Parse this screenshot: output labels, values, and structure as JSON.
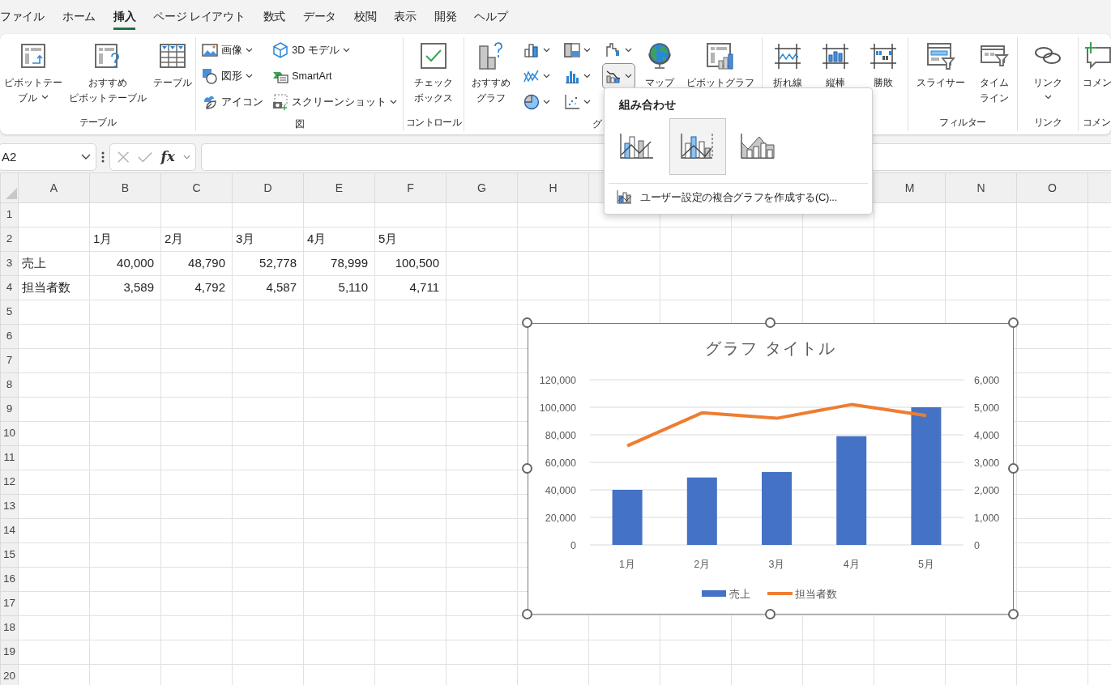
{
  "menu_tabs": [
    {
      "label": "ファイル",
      "selected": false
    },
    {
      "label": "ホーム",
      "selected": false
    },
    {
      "label": "挿入",
      "selected": true
    },
    {
      "label": "ページ レイアウト",
      "selected": false
    },
    {
      "label": "数式",
      "selected": false
    },
    {
      "label": "データ",
      "selected": false
    },
    {
      "label": "校閲",
      "selected": false
    },
    {
      "label": "表示",
      "selected": false
    },
    {
      "label": "開発",
      "selected": false
    },
    {
      "label": "ヘルプ",
      "selected": false
    }
  ],
  "ribbon": {
    "groups": [
      {
        "label": "テーブル",
        "items": [
          {
            "kind": "large",
            "lines": [
              "ピボットテー",
              "ブル"
            ],
            "dropdown": true
          },
          {
            "kind": "large",
            "lines": [
              "おすすめ",
              "ピボットテーブル"
            ],
            "dropdown": false
          },
          {
            "kind": "large",
            "lines": [
              "テーブル"
            ],
            "dropdown": false
          }
        ]
      },
      {
        "label": "図",
        "items": [
          {
            "kind": "small",
            "label": "画像",
            "dropdown": true
          },
          {
            "kind": "small",
            "label": "図形",
            "dropdown": true
          },
          {
            "kind": "small",
            "label": "アイコン",
            "dropdown": false
          },
          {
            "kind": "small",
            "label": "3D モデル",
            "dropdown": true
          },
          {
            "kind": "small",
            "label": "SmartArt",
            "dropdown": false
          },
          {
            "kind": "small",
            "label": "スクリーンショット",
            "dropdown": true
          }
        ]
      },
      {
        "label": "コントロール",
        "items": [
          {
            "kind": "large",
            "lines": [
              "チェック",
              "ボックス"
            ],
            "dropdown": false
          }
        ]
      },
      {
        "label": "グ",
        "items": [
          {
            "kind": "large",
            "lines": [
              "おすすめ",
              "グラフ"
            ],
            "dropdown": false
          },
          {
            "kind": "icon",
            "dropdown": true,
            "pressed": false
          },
          {
            "kind": "icon",
            "dropdown": true,
            "pressed": false
          },
          {
            "kind": "icon",
            "dropdown": true,
            "pressed": false
          },
          {
            "kind": "icon",
            "dropdown": true,
            "pressed": false
          },
          {
            "kind": "icon",
            "dropdown": true,
            "pressed": false
          },
          {
            "kind": "icon",
            "dropdown": true,
            "pressed": false
          },
          {
            "kind": "icon",
            "dropdown": true,
            "pressed": false
          },
          {
            "kind": "icon",
            "dropdown": true,
            "pressed": true
          },
          {
            "kind": "large",
            "lines": [
              "マップ"
            ],
            "dropdown": false
          },
          {
            "kind": "large",
            "lines": [
              "ピボットグラフ"
            ],
            "dropdown": false
          }
        ]
      },
      {
        "items": [
          {
            "kind": "large",
            "lines": [
              "折れ線"
            ],
            "dropdown": false
          },
          {
            "kind": "large",
            "lines": [
              "縦棒"
            ],
            "dropdown": false
          },
          {
            "kind": "large",
            "lines": [
              "勝敗"
            ],
            "dropdown": false
          }
        ]
      },
      {
        "label": "フィルター",
        "items": [
          {
            "kind": "large",
            "lines": [
              "スライサー"
            ],
            "dropdown": false
          },
          {
            "kind": "large",
            "lines": [
              "タイム",
              "ライン"
            ],
            "dropdown": false
          }
        ]
      },
      {
        "label": "リンク",
        "items": [
          {
            "kind": "large",
            "lines": [
              "リンク"
            ],
            "dropdown": true
          }
        ]
      },
      {
        "label": "コメン",
        "items": [
          {
            "kind": "large",
            "lines": [
              "コメン"
            ],
            "dropdown": false
          }
        ]
      }
    ]
  },
  "combo_menu": {
    "title": "組み合わせ",
    "options": [
      {
        "selected": false
      },
      {
        "selected": true
      },
      {
        "selected": false
      }
    ],
    "items": [
      {
        "label": "ユーザー設定の複合グラフを作成する(C)..."
      }
    ]
  },
  "formula_bar": {
    "name_box": "A2",
    "function_label": "fx"
  },
  "sheet": {
    "columns": [
      "A",
      "B",
      "C",
      "D",
      "E",
      "F",
      "G",
      "H",
      null,
      null,
      null,
      null,
      "M",
      "N",
      "O"
    ],
    "rows": [
      {
        "header": "1"
      },
      {
        "header": "2",
        "cells": [
          null,
          {
            "text": "1月",
            "kind": "text"
          },
          {
            "text": "2月",
            "kind": "text"
          },
          {
            "text": "3月",
            "kind": "text"
          },
          {
            "text": "4月",
            "kind": "text"
          },
          {
            "text": "5月",
            "kind": "text"
          }
        ]
      },
      {
        "header": "3",
        "cells": [
          {
            "text": "売上",
            "kind": "text"
          },
          {
            "text": "40,000",
            "kind": "number"
          },
          {
            "text": "48,790",
            "kind": "number"
          },
          {
            "text": "52,778",
            "kind": "number"
          },
          {
            "text": "78,999",
            "kind": "number"
          },
          {
            "text": "100,500",
            "kind": "number"
          }
        ]
      },
      {
        "header": "4",
        "cells": [
          {
            "text": "担当者数",
            "kind": "text"
          },
          {
            "text": "3,589",
            "kind": "number"
          },
          {
            "text": "4,792",
            "kind": "number"
          },
          {
            "text": "4,587",
            "kind": "number"
          },
          {
            "text": "5,110",
            "kind": "number"
          },
          {
            "text": "4,711",
            "kind": "number"
          }
        ]
      },
      {
        "header": "5"
      },
      {
        "header": "6"
      },
      {
        "header": "7"
      },
      {
        "header": "8"
      },
      {
        "header": "9"
      },
      {
        "header": "10"
      },
      {
        "header": "11"
      },
      {
        "header": "12"
      },
      {
        "header": "13"
      },
      {
        "header": "14"
      },
      {
        "header": "15"
      },
      {
        "header": "16"
      },
      {
        "header": "17"
      },
      {
        "header": "18"
      },
      {
        "header": "19"
      },
      {
        "header": "20"
      }
    ]
  },
  "chart": {
    "selected": true,
    "chart_data": {
      "type": "bar",
      "title": "グラフ タイトル",
      "grid": true,
      "legend": true,
      "categories": [
        "1月",
        "2月",
        "3月",
        "4月",
        "5月"
      ],
      "series": [
        {
          "name": "売上",
          "color": "#4472c4",
          "type": "bar",
          "values": [
            40000,
            49000,
            53000,
            79000,
            100000
          ]
        },
        {
          "name": "担当者数",
          "color": "#ed7d31",
          "type": "line",
          "axis": "y2",
          "values": [
            3600,
            4800,
            4600,
            5100,
            4700
          ]
        }
      ],
      "ylim": [
        0,
        120000
      ],
      "yticks": [
        {
          "value": 0,
          "label": "0"
        },
        {
          "value": 20000,
          "label": "20,000"
        },
        {
          "value": 40000,
          "label": "40,000"
        },
        {
          "value": 60000,
          "label": "60,000"
        },
        {
          "value": 80000,
          "label": "80,000"
        },
        {
          "value": 100000,
          "label": "100,000"
        },
        {
          "value": 120000,
          "label": "120,000"
        }
      ],
      "y2lim": [
        0,
        6000
      ],
      "y2ticks": [
        {
          "value": 0,
          "label": "0"
        },
        {
          "value": 1000,
          "label": "1,000"
        },
        {
          "value": 2000,
          "label": "2,000"
        },
        {
          "value": 3000,
          "label": "3,000"
        },
        {
          "value": 4000,
          "label": "4,000"
        },
        {
          "value": 5000,
          "label": "5,000"
        },
        {
          "value": 6000,
          "label": "6,000"
        }
      ]
    }
  }
}
